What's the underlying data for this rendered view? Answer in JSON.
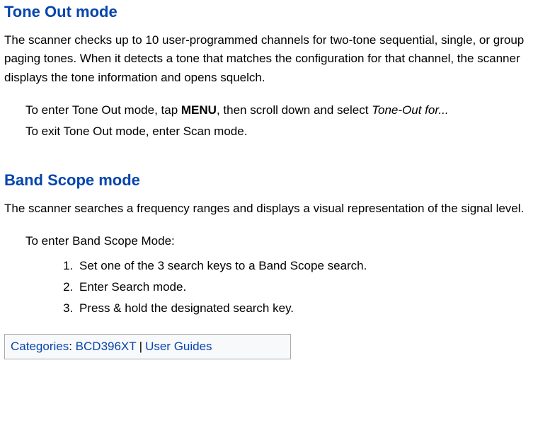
{
  "section1": {
    "title": "Tone Out mode",
    "para": "The scanner checks up to 10 user-programmed channels for two-tone sequential, single, or group paging tones. When it detects a tone that matches the configuration for that channel, the scanner displays the tone information and opens squelch.",
    "enter_line": {
      "pre": "To enter Tone Out mode, tap ",
      "bold": "MENU",
      "mid": ", then scroll down and select ",
      "italic": "Tone-Out for..."
    },
    "exit_line": "To exit Tone Out mode, enter Scan mode."
  },
  "section2": {
    "title": "Band Scope mode",
    "para": "The scanner searches a frequency ranges and displays a visual representation of the signal level.",
    "enter_intro": "To enter Band Scope Mode:",
    "steps": [
      "Set one of the 3 search keys to a Band Scope search.",
      "Enter Search mode.",
      "Press & hold the designated search key."
    ]
  },
  "categories": {
    "label": "Categories",
    "sep_after_label": ": ",
    "items": [
      "BCD396XT",
      "User Guides"
    ],
    "item_sep": "|"
  }
}
